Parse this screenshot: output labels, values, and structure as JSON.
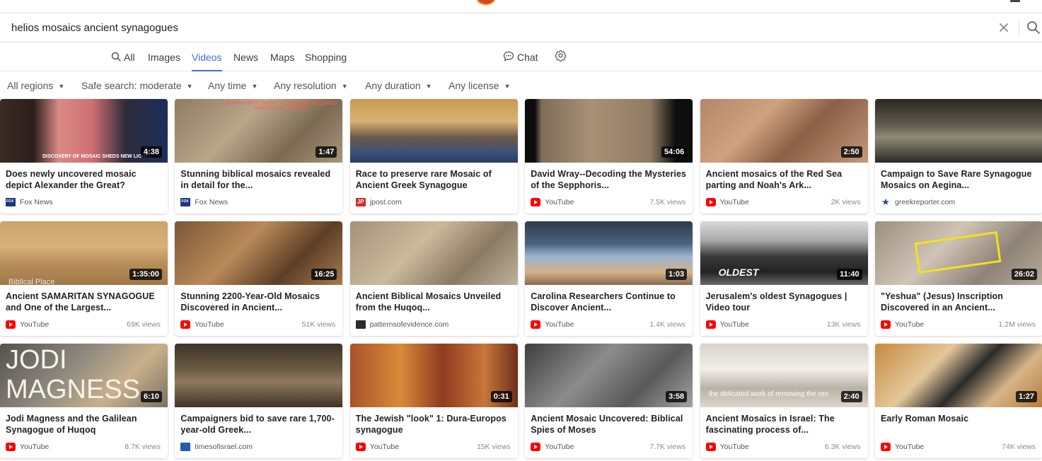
{
  "search": {
    "query": "helios mosaics ancient synagogues",
    "clear_icon": "close-icon",
    "search_icon": "search-icon"
  },
  "tabs": [
    {
      "label": "All",
      "icon": "search-icon"
    },
    {
      "label": "Images"
    },
    {
      "label": "Videos",
      "active": true
    },
    {
      "label": "News"
    },
    {
      "label": "Maps"
    },
    {
      "label": "Shopping"
    }
  ],
  "chat": {
    "label": "Chat",
    "icon": "chat-bubble-icon"
  },
  "settings": {
    "icon": "gear-icon"
  },
  "filters": [
    {
      "label": "All regions"
    },
    {
      "label": "Safe search: moderate"
    },
    {
      "label": "Any time"
    },
    {
      "label": "Any resolution"
    },
    {
      "label": "Any duration"
    },
    {
      "label": "Any license"
    }
  ],
  "colors": {
    "accent": "#3b6fd4",
    "youtube": "#ff0000"
  },
  "videos": [
    {
      "title": "Does newly uncovered mosaic depict Alexander the Great?",
      "source": "Fox News",
      "source_icon": "fox-news-icon",
      "views": "",
      "duration": "4:38",
      "overlay": "DISCOVERY OF MOSAIC SHEDS NEW LIGHT"
    },
    {
      "title": "Stunning biblical mosaics revealed in detail for the...",
      "source": "Fox News",
      "source_icon": "fox-news-icon",
      "views": "",
      "duration": "1:47",
      "overlay": "JEWISH SETTLEMENT IN THE AREA DECLINED DURING THAT PERIOD."
    },
    {
      "title": "Race to preserve rare Mosaic of Ancient Greek Synagogue",
      "source": "jpost.com",
      "source_icon": "jpost-icon",
      "views": "",
      "duration": "",
      "overlay": ""
    },
    {
      "title": "David Wray--Decoding the Mysteries of the Sepphoris...",
      "source": "YouTube",
      "source_icon": "youtube-icon",
      "views": "7.5K views",
      "duration": "54:06",
      "overlay": ""
    },
    {
      "title": "Ancient mosaics of the Red Sea parting and Noah's Ark...",
      "source": "YouTube",
      "source_icon": "youtube-icon",
      "views": "2K views",
      "duration": "2:50",
      "overlay": ""
    },
    {
      "title": "Campaign to Save Rare Synagogue Mosaics on Aegina...",
      "source": "greekreporter.com",
      "source_icon": "star-icon",
      "views": "",
      "duration": "",
      "overlay": ""
    },
    {
      "title": "Ancient SAMARITAN SYNAGOGUE and One of the Largest...",
      "source": "YouTube",
      "source_icon": "youtube-icon",
      "views": "69K views",
      "duration": "1:35:00",
      "overlay": "Biblical Place"
    },
    {
      "title": "Stunning 2200-Year-Old Mosaics Discovered in Ancient...",
      "source": "YouTube",
      "source_icon": "youtube-icon",
      "views": "51K views",
      "duration": "16:25",
      "overlay": ""
    },
    {
      "title": "Ancient Biblical Mosaics Unveiled from the Huqoq...",
      "source": "patternsofevidence.com",
      "source_icon": "patterns-of-evidence-icon",
      "views": "",
      "duration": "",
      "overlay": ""
    },
    {
      "title": "Carolina Researchers Continue to Discover Ancient...",
      "source": "YouTube",
      "source_icon": "youtube-icon",
      "views": "1.4K views",
      "duration": "1:03",
      "overlay": ""
    },
    {
      "title": "Jerusalem's oldest Synagogues | Video tour",
      "source": "YouTube",
      "source_icon": "youtube-icon",
      "views": "13K views",
      "duration": "11:40",
      "overlay": "OLDEST"
    },
    {
      "title": "\"Yeshua\" (Jesus) Inscription Discovered in an Ancient...",
      "source": "YouTube",
      "source_icon": "youtube-icon",
      "views": "1.2M views",
      "duration": "26:02",
      "overlay": ""
    },
    {
      "title": "Jodi Magness and the Galilean Synagogue of Huqoq",
      "source": "YouTube",
      "source_icon": "youtube-icon",
      "views": "8.7K views",
      "duration": "6:10",
      "overlay": "JODI MAGNESS"
    },
    {
      "title": "Campaigners bid to save rare 1,700-year-old Greek...",
      "source": "timesofisrael.com",
      "source_icon": "times-of-israel-icon",
      "views": "",
      "duration": "",
      "overlay": ""
    },
    {
      "title": "The Jewish \"look\" 1: Dura-Europos synagogue",
      "source": "YouTube",
      "source_icon": "youtube-icon",
      "views": "15K views",
      "duration": "0:31",
      "overlay": ""
    },
    {
      "title": "Ancient Mosaic Uncovered: Biblical Spies of Moses",
      "source": "YouTube",
      "source_icon": "youtube-icon",
      "views": "7.7K views",
      "duration": "3:58",
      "overlay": ""
    },
    {
      "title": "Ancient Mosaics in Israel: The fascinating process of...",
      "source": "YouTube",
      "source_icon": "youtube-icon",
      "views": "6.3K views",
      "duration": "2:40",
      "overlay": "the delicated work of removing the ren"
    },
    {
      "title": "Early Roman Mosaic",
      "source": "YouTube",
      "source_icon": "youtube-icon",
      "views": "74K views",
      "duration": "1:27",
      "overlay": ""
    }
  ]
}
